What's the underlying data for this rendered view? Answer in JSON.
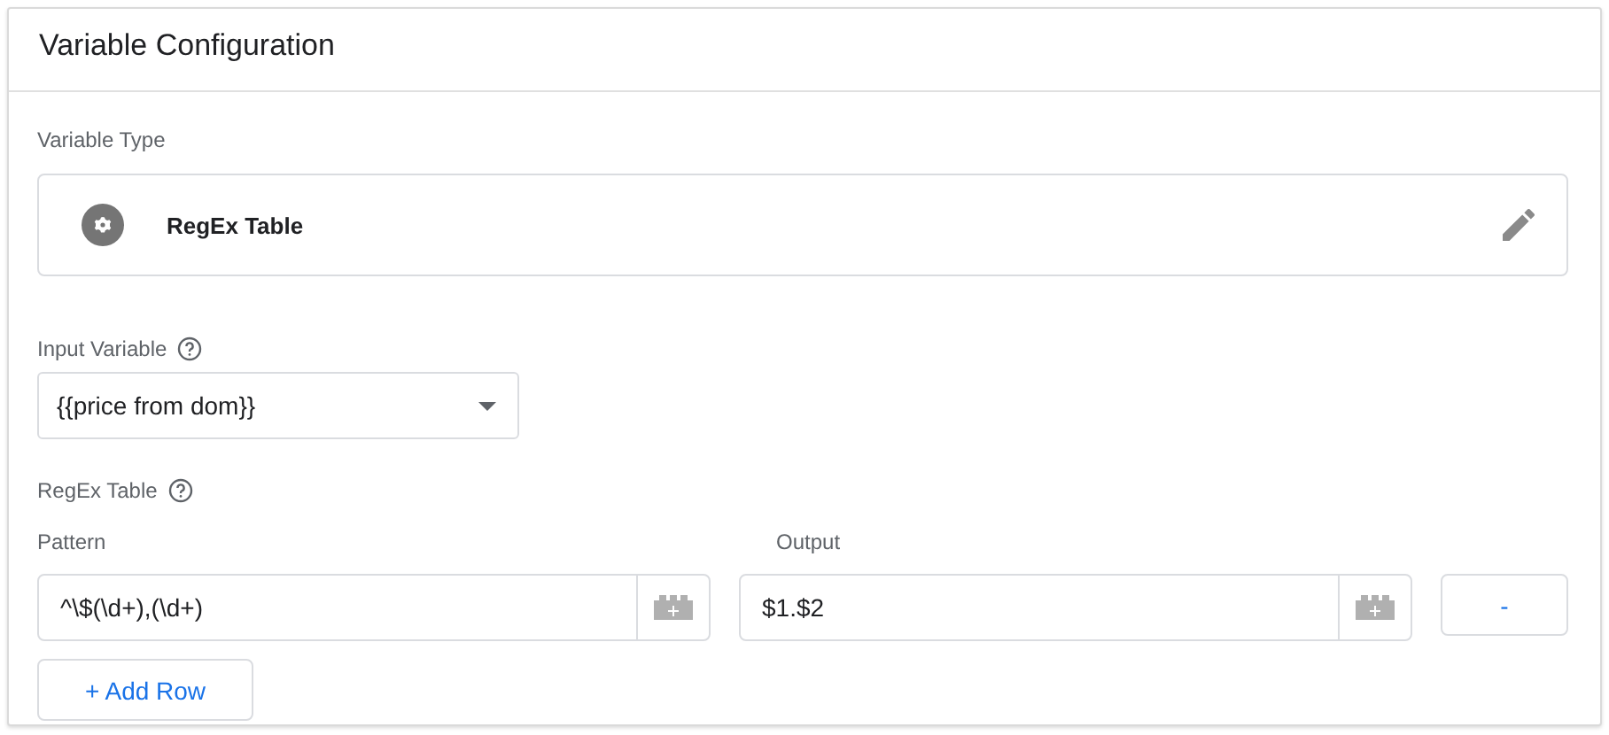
{
  "panel": {
    "title": "Variable Configuration"
  },
  "variable_type": {
    "label": "Variable Type",
    "name": "RegEx Table"
  },
  "input_variable": {
    "label": "Input Variable",
    "value": "{{price from dom}}"
  },
  "regex_table": {
    "label": "RegEx Table",
    "columns": [
      "Pattern",
      "Output"
    ],
    "rows": [
      {
        "pattern": "^\\$(\\d+),(\\d+)",
        "output": "$1.$2",
        "remove": "-"
      }
    ],
    "add_button": "+ Add Row"
  }
}
